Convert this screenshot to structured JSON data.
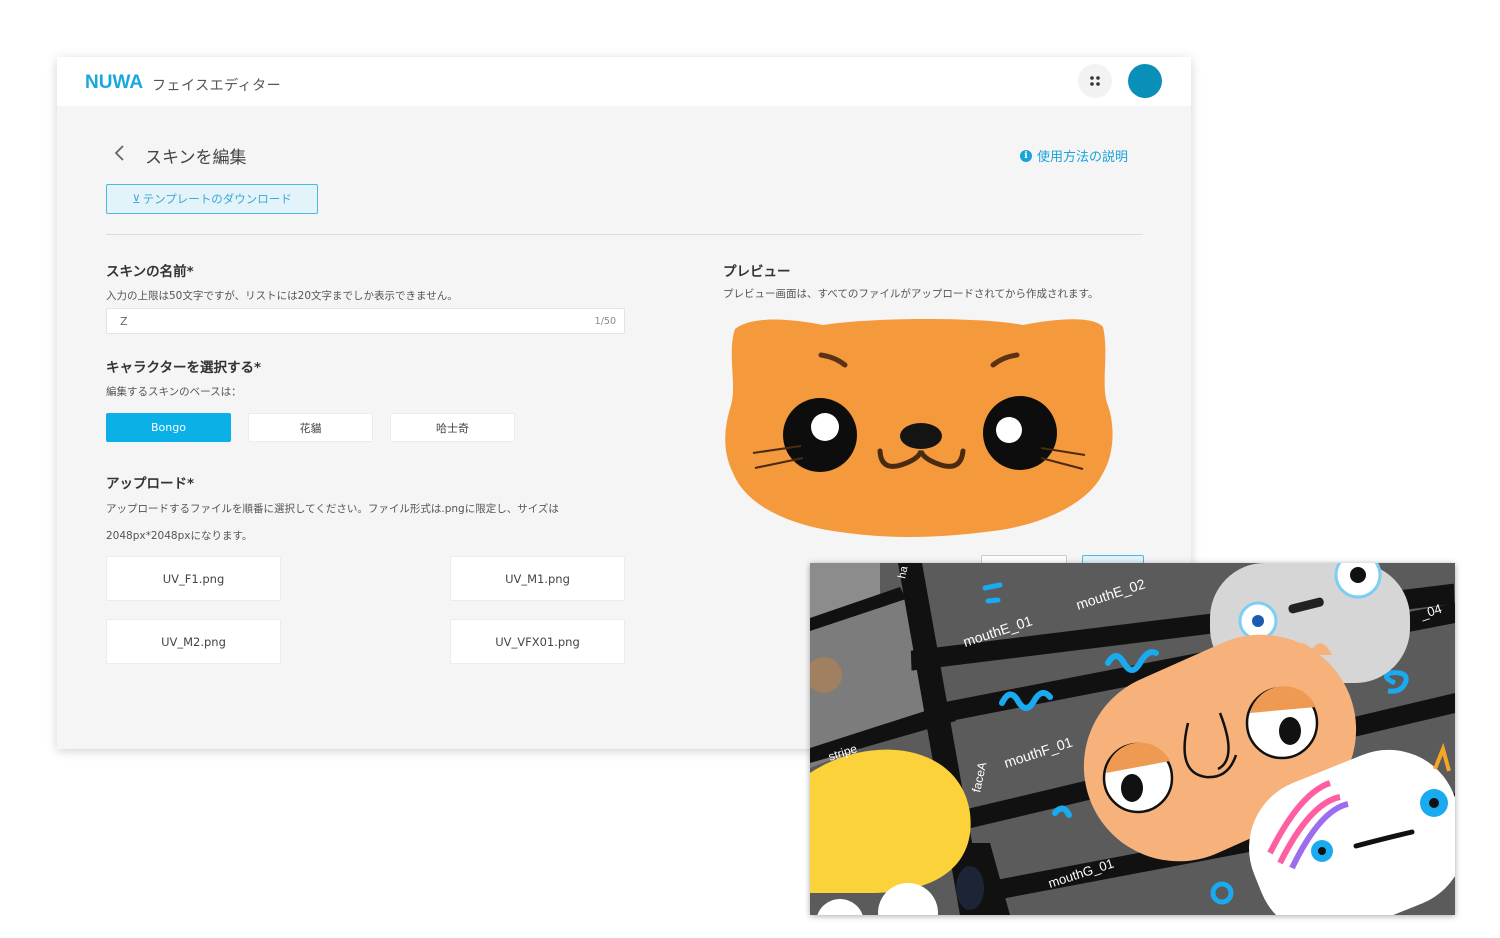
{
  "header": {
    "logo_text": "NUWA",
    "app_title": "フェイスエディター"
  },
  "page": {
    "title": "スキンを編集",
    "help_text": "使用方法の説明",
    "template_button": "テンプレートのダウンロード",
    "template_icon_glyph": "⊻"
  },
  "skin_name": {
    "title": "スキンの名前*",
    "description": "入力の上限は50文字ですが、リストには20文字までしか表示できません。",
    "value": "Z",
    "counter": "1/50"
  },
  "character": {
    "title": "キャラクターを選択する*",
    "description": "編集するスキンのベースは：",
    "options": [
      "Bongo",
      "花貓",
      "哈士奇"
    ],
    "selected": "Bongo"
  },
  "upload": {
    "title": "アップロード*",
    "description_line1": "アップロードするファイルを順番に選択してください。ファイル形式は.pngに限定し、サイズは",
    "description_line2": "2048px*2048pxになります。",
    "files": [
      "UV_F1.png",
      "UV_M1.png",
      "UV_M2.png",
      "UV_VFX01.png"
    ]
  },
  "preview": {
    "title": "プレビュー",
    "description": "プレビュー画面は、すべてのファイルがアップロードされてから作成されます。"
  },
  "texture_sheet": {
    "labels": [
      "mouthE_01",
      "mouthE_02",
      "mouthF_01",
      "mouthG_01",
      "stripe",
      "faceA",
      "ha",
      "_04"
    ]
  },
  "colors": {
    "accent": "#0ab0e6",
    "link": "#19a3d8",
    "avatar": "#0a8fb8",
    "cat_orange": "#f59a3c",
    "sheet_bg": "#5b5b5b"
  },
  "icons": [
    "back-chevron-icon",
    "info-icon",
    "download-icon",
    "apps-grid-icon"
  ]
}
